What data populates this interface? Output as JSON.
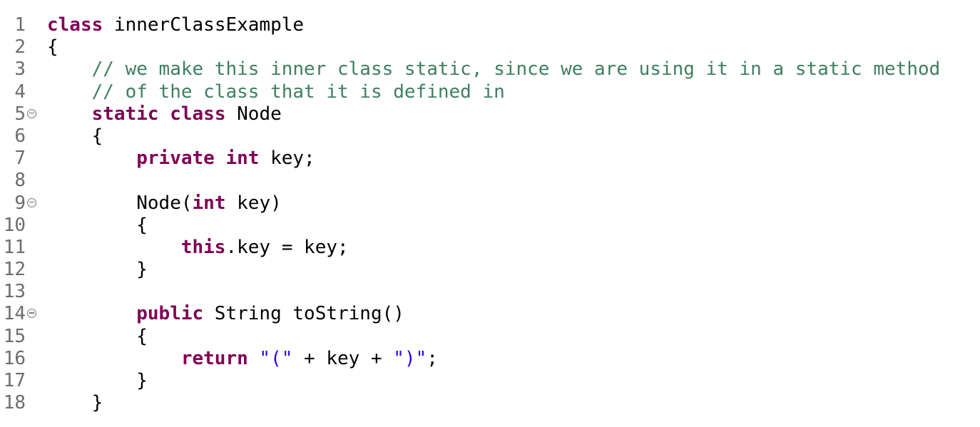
{
  "colors": {
    "keyword": "#7f0055",
    "comment": "#3f7f5f",
    "string": "#2a00ff",
    "line_number": "#6d6d6d"
  },
  "lines": [
    {
      "n": "1",
      "fold": false,
      "indent": "",
      "tokens": [
        {
          "t": "kw",
          "v": "class"
        },
        {
          "t": "pl",
          "v": " innerClassExample"
        }
      ]
    },
    {
      "n": "2",
      "fold": false,
      "indent": "",
      "tokens": [
        {
          "t": "pl",
          "v": "{"
        }
      ]
    },
    {
      "n": "3",
      "fold": false,
      "indent": "    ",
      "tokens": [
        {
          "t": "cm",
          "v": "// we make this inner class static, since we are using it in a static method"
        }
      ]
    },
    {
      "n": "4",
      "fold": false,
      "indent": "    ",
      "tokens": [
        {
          "t": "cm",
          "v": "// of the class that it is defined in"
        }
      ]
    },
    {
      "n": "5",
      "fold": true,
      "indent": "    ",
      "tokens": [
        {
          "t": "kw",
          "v": "static"
        },
        {
          "t": "pl",
          "v": " "
        },
        {
          "t": "kw",
          "v": "class"
        },
        {
          "t": "pl",
          "v": " Node"
        }
      ]
    },
    {
      "n": "6",
      "fold": false,
      "indent": "    ",
      "tokens": [
        {
          "t": "pl",
          "v": "{"
        }
      ]
    },
    {
      "n": "7",
      "fold": false,
      "indent": "        ",
      "tokens": [
        {
          "t": "kw",
          "v": "private"
        },
        {
          "t": "pl",
          "v": " "
        },
        {
          "t": "kw",
          "v": "int"
        },
        {
          "t": "pl",
          "v": " key;"
        }
      ]
    },
    {
      "n": "8",
      "fold": false,
      "indent": "",
      "tokens": []
    },
    {
      "n": "9",
      "fold": true,
      "indent": "        ",
      "tokens": [
        {
          "t": "pl",
          "v": "Node("
        },
        {
          "t": "kw",
          "v": "int"
        },
        {
          "t": "pl",
          "v": " key)"
        }
      ]
    },
    {
      "n": "10",
      "fold": false,
      "indent": "        ",
      "tokens": [
        {
          "t": "pl",
          "v": "{"
        }
      ]
    },
    {
      "n": "11",
      "fold": false,
      "indent": "            ",
      "tokens": [
        {
          "t": "kw",
          "v": "this"
        },
        {
          "t": "pl",
          "v": ".key = key;"
        }
      ]
    },
    {
      "n": "12",
      "fold": false,
      "indent": "        ",
      "tokens": [
        {
          "t": "pl",
          "v": "}"
        }
      ]
    },
    {
      "n": "13",
      "fold": false,
      "indent": "",
      "tokens": []
    },
    {
      "n": "14",
      "fold": true,
      "indent": "        ",
      "tokens": [
        {
          "t": "kw",
          "v": "public"
        },
        {
          "t": "pl",
          "v": " String toString()"
        }
      ]
    },
    {
      "n": "15",
      "fold": false,
      "indent": "        ",
      "tokens": [
        {
          "t": "pl",
          "v": "{"
        }
      ]
    },
    {
      "n": "16",
      "fold": false,
      "indent": "            ",
      "tokens": [
        {
          "t": "kw",
          "v": "return"
        },
        {
          "t": "pl",
          "v": " "
        },
        {
          "t": "st",
          "v": "\"(\""
        },
        {
          "t": "pl",
          "v": " + key + "
        },
        {
          "t": "st",
          "v": "\")\""
        },
        {
          "t": "pl",
          "v": ";"
        }
      ]
    },
    {
      "n": "17",
      "fold": false,
      "indent": "        ",
      "tokens": [
        {
          "t": "pl",
          "v": "}"
        }
      ]
    },
    {
      "n": "18",
      "fold": false,
      "indent": "    ",
      "tokens": [
        {
          "t": "pl",
          "v": "}"
        }
      ]
    }
  ]
}
